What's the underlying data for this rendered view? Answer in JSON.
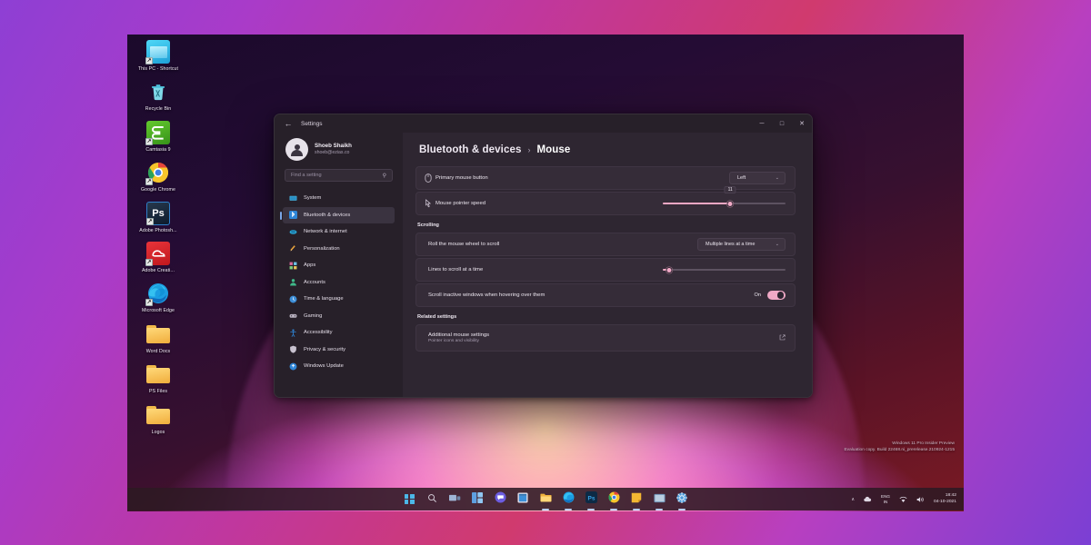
{
  "desktop": {
    "icons": [
      {
        "label": "This PC - Shortcut",
        "icon": "this-pc-icon",
        "shortcut": true
      },
      {
        "label": "Recycle Bin",
        "icon": "recycle-bin-icon",
        "shortcut": false
      },
      {
        "label": "Camtasia 9",
        "icon": "camtasia-icon",
        "shortcut": true
      },
      {
        "label": "Google Chrome",
        "icon": "chrome-icon",
        "shortcut": true
      },
      {
        "label": "Adobe Photosh...",
        "icon": "photoshop-icon",
        "shortcut": true
      },
      {
        "label": "Adobe Creati...",
        "icon": "adobe-creative-cloud-icon",
        "shortcut": true
      },
      {
        "label": "Microsoft Edge",
        "icon": "edge-icon",
        "shortcut": true
      },
      {
        "label": "Word Docs",
        "icon": "folder-icon",
        "shortcut": false
      },
      {
        "label": "PS Files",
        "icon": "folder-icon",
        "shortcut": false
      },
      {
        "label": "Logos",
        "icon": "folder-icon",
        "shortcut": false
      }
    ],
    "watermark_line1": "Windows 11 Pro Insider Preview",
    "watermark_line2": "Evaluation copy. Build 22468.ni_prerelease.210924-1215"
  },
  "window": {
    "title": "Settings",
    "back_icon": "back-arrow-icon",
    "minimize_label": "─",
    "maximize_label": "□",
    "close_label": "✕"
  },
  "sidebar": {
    "profile": {
      "name": "Shoeb Shaikh",
      "email": "shoeb@ezias.co"
    },
    "search": {
      "placeholder": "Find a setting",
      "value": "",
      "icon": "search-icon"
    },
    "items": [
      {
        "label": "System",
        "icon": "system-icon",
        "active": false
      },
      {
        "label": "Bluetooth & devices",
        "icon": "bluetooth-icon",
        "active": true
      },
      {
        "label": "Network & internet",
        "icon": "network-icon",
        "active": false
      },
      {
        "label": "Personalization",
        "icon": "personalization-icon",
        "active": false
      },
      {
        "label": "Apps",
        "icon": "apps-icon",
        "active": false
      },
      {
        "label": "Accounts",
        "icon": "accounts-icon",
        "active": false
      },
      {
        "label": "Time & language",
        "icon": "time-language-icon",
        "active": false
      },
      {
        "label": "Gaming",
        "icon": "gaming-icon",
        "active": false
      },
      {
        "label": "Accessibility",
        "icon": "accessibility-icon",
        "active": false
      },
      {
        "label": "Privacy & security",
        "icon": "privacy-security-icon",
        "active": false
      },
      {
        "label": "Windows Update",
        "icon": "windows-update-icon",
        "active": false
      }
    ]
  },
  "main": {
    "breadcrumb": {
      "parent": "Bluetooth & devices",
      "separator": "›",
      "current": "Mouse"
    },
    "primary_mouse_button": {
      "label": "Primary mouse button",
      "icon": "mouse-icon",
      "value": "Left",
      "chevron": "⌄"
    },
    "mouse_pointer_speed": {
      "label": "Mouse pointer speed",
      "icon": "pointer-icon",
      "value": "11",
      "percent": 55
    },
    "scrolling_section": "Scrolling",
    "roll_mouse_wheel": {
      "label": "Roll the mouse wheel to scroll",
      "value": "Multiple lines at a time",
      "chevron": "⌄"
    },
    "lines_to_scroll": {
      "label": "Lines to scroll at a time",
      "percent": 5
    },
    "scroll_inactive": {
      "label": "Scroll inactive windows when hovering over them",
      "state": "On"
    },
    "related_section": "Related settings",
    "additional_mouse": {
      "title": "Additional mouse settings",
      "subtitle": "Pointer icons and visibility",
      "icon": "external-link-icon"
    }
  },
  "taskbar": {
    "items": [
      {
        "name": "start-button",
        "icon": "windows-logo-icon",
        "active": false
      },
      {
        "name": "search-button",
        "icon": "search-icon",
        "active": false
      },
      {
        "name": "task-view-button",
        "icon": "task-view-icon",
        "active": false
      },
      {
        "name": "widgets-button",
        "icon": "widgets-icon",
        "active": false
      },
      {
        "name": "teams-chat-button",
        "icon": "teams-chat-icon",
        "active": false
      },
      {
        "name": "store-button",
        "icon": "microsoft-store-icon",
        "active": false
      },
      {
        "name": "file-explorer-button",
        "icon": "file-explorer-icon",
        "active": true
      },
      {
        "name": "edge-button",
        "icon": "edge-icon",
        "active": true
      },
      {
        "name": "photoshop-button",
        "icon": "photoshop-icon",
        "active": true
      },
      {
        "name": "chrome-button",
        "icon": "chrome-icon",
        "active": true
      },
      {
        "name": "notes-button",
        "icon": "notes-icon",
        "active": true
      },
      {
        "name": "camtasia-button",
        "icon": "camtasia-icon",
        "active": true
      },
      {
        "name": "settings-button",
        "icon": "settings-gear-icon",
        "active": true
      }
    ],
    "tray": {
      "chevron": "∧",
      "onedrive_icon": "cloud-icon",
      "language_line1": "ENG",
      "language_line2": "IN",
      "wifi_icon": "wifi-icon",
      "volume_icon": "volume-icon",
      "time": "18:42",
      "date": "04-10-2021"
    }
  }
}
